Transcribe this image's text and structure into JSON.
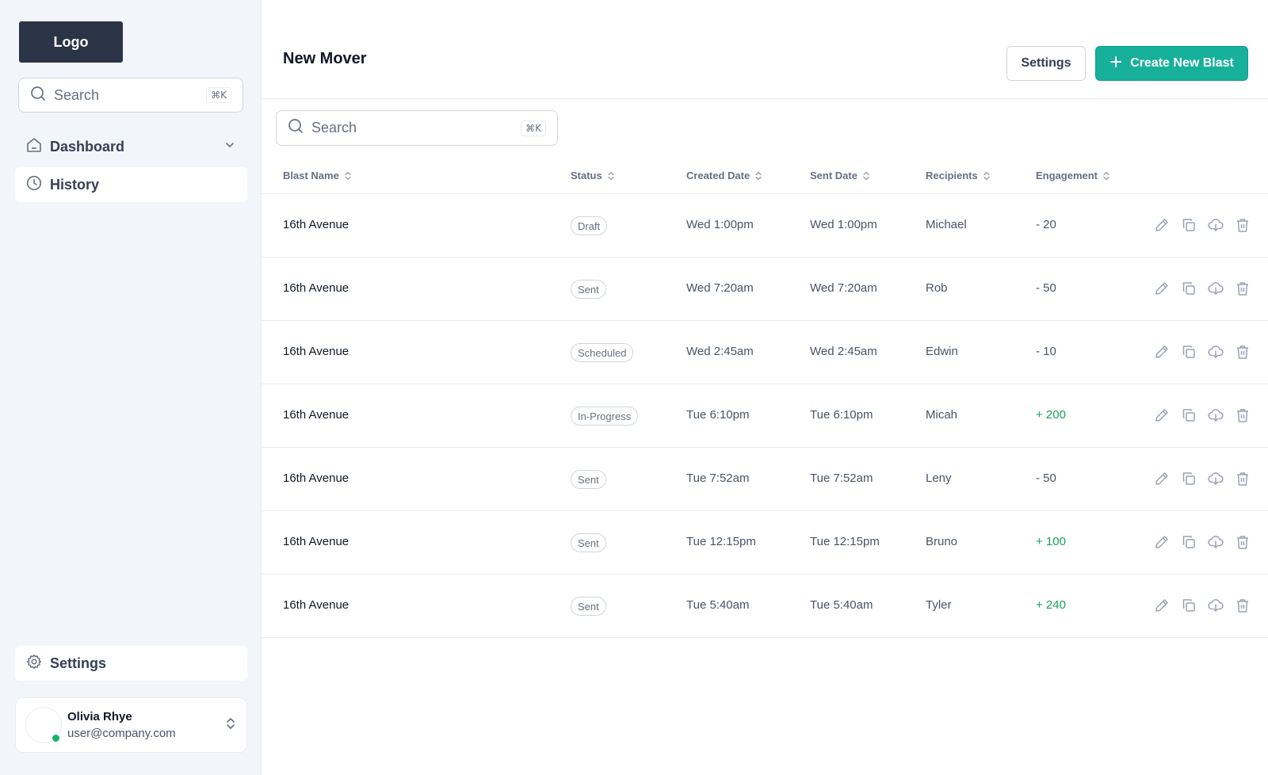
{
  "sidebar": {
    "logo": "Logo",
    "search": {
      "placeholder": "Search",
      "shortcut": "⌘K"
    },
    "nav": [
      {
        "label": "Dashboard",
        "icon": "home-icon"
      },
      {
        "label": "History",
        "icon": "clock-icon"
      }
    ],
    "settings_label": "Settings",
    "user": {
      "name": "Olivia Rhye",
      "email": "user@company.com",
      "status_color": "#12b76a"
    }
  },
  "header": {
    "title": "New Mover",
    "settings_button": "Settings",
    "create_button": "Create New Blast",
    "accent_color": "#17b09b"
  },
  "search": {
    "placeholder": "Search",
    "shortcut": "⌘K"
  },
  "table": {
    "columns": [
      "Blast Name",
      "Status",
      "Created Date",
      "Sent Date",
      "Recipients",
      "Engagement"
    ],
    "rows": [
      {
        "name": "16th Avenue",
        "status": "Draft",
        "created": "Wed 1:00pm",
        "sent": "Wed 1:00pm",
        "recipient": "Michael",
        "engagement": "- 20",
        "positive": false
      },
      {
        "name": "16th Avenue",
        "status": "Sent",
        "created": "Wed 7:20am",
        "sent": "Wed 7:20am",
        "recipient": "Rob",
        "engagement": "- 50",
        "positive": false
      },
      {
        "name": "16th Avenue",
        "status": "Scheduled",
        "created": "Wed 2:45am",
        "sent": "Wed 2:45am",
        "recipient": "Edwin",
        "engagement": "- 10",
        "positive": false
      },
      {
        "name": "16th Avenue",
        "status": "In-Progress",
        "created": "Tue 6:10pm",
        "sent": "Tue 6:10pm",
        "recipient": "Micah",
        "engagement": "+ 200",
        "positive": true
      },
      {
        "name": "16th Avenue",
        "status": "Sent",
        "created": "Tue 7:52am",
        "sent": "Tue 7:52am",
        "recipient": "Leny",
        "engagement": "- 50",
        "positive": false
      },
      {
        "name": "16th Avenue",
        "status": "Sent",
        "created": "Tue 12:15pm",
        "sent": "Tue 12:15pm",
        "recipient": "Bruno",
        "engagement": "+ 100",
        "positive": true
      },
      {
        "name": "16th Avenue",
        "status": "Sent",
        "created": "Tue 5:40am",
        "sent": "Tue 5:40am",
        "recipient": "Tyler",
        "engagement": "+ 240",
        "positive": true
      }
    ],
    "row_actions": [
      "edit-icon",
      "copy-icon",
      "download-icon",
      "trash-icon"
    ]
  }
}
